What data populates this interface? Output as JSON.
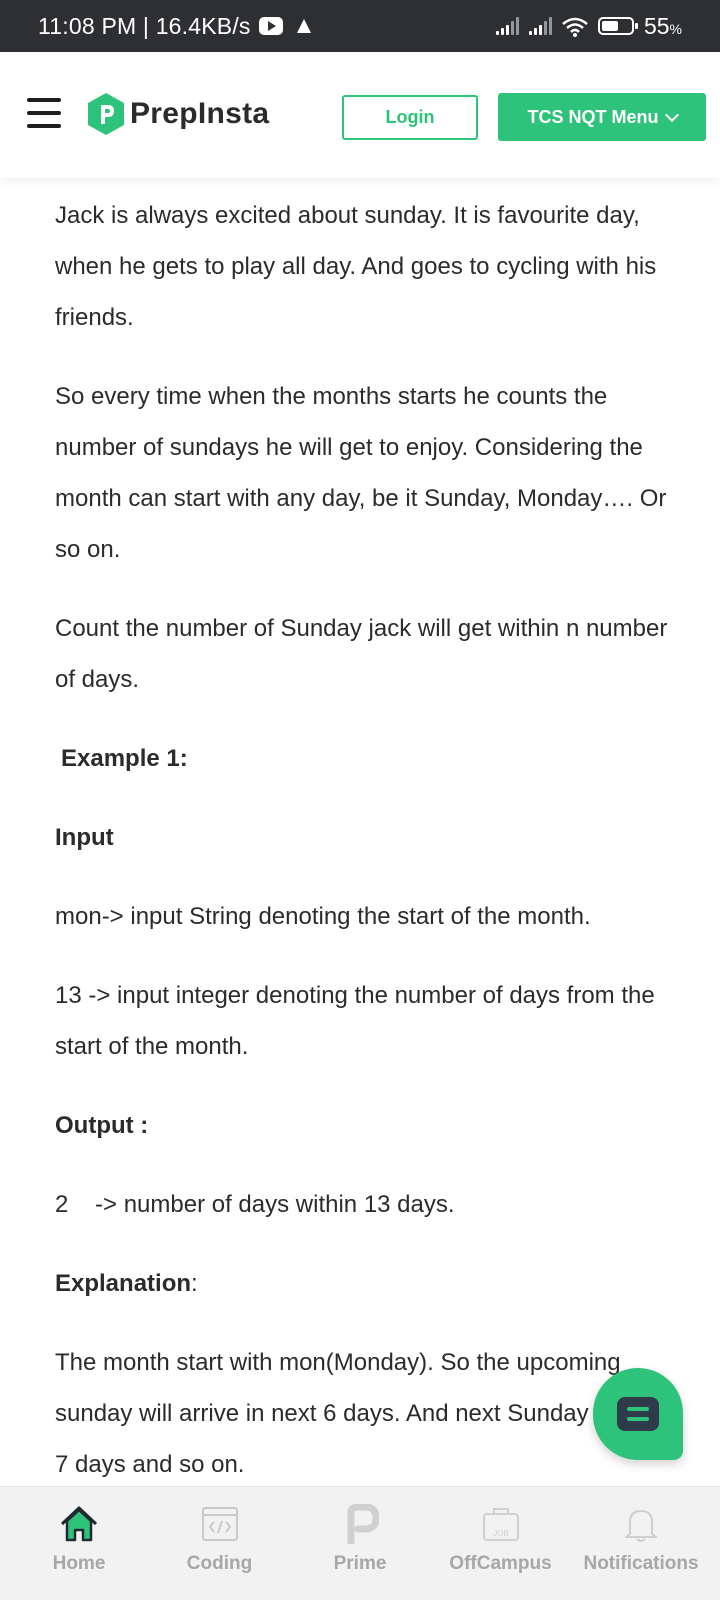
{
  "status_bar": {
    "time_speed": "11:08 PM | 16.4KB/s",
    "battery": "55",
    "battery_unit": "%"
  },
  "header": {
    "logo_text": "PrepInsta",
    "login_label": "Login",
    "menu_label": "TCS NQT Menu"
  },
  "content": {
    "para1": "Jack is always excited about sunday. It is favourite day, when he gets to play all day. And goes to cycling with his friends.",
    "para2": "So every time when the months starts he counts the number of sundays he will get to enjoy. Considering the month can start with any day, be it Sunday, Monday…. Or so on.",
    "para3": "Count the number of Sunday jack will get within n number of days.",
    "example_heading": "Example 1:",
    "input_heading": "Input",
    "input_line1": "mon-> input String denoting the start of the month.",
    "input_line2": "13  -> input integer denoting the number of days from the start of the month.",
    "output_heading": "Output :",
    "output_line": "2    -> number of days within 13 days.",
    "explanation_heading": "Explanation",
    "explanation_colon": ":",
    "explanation_text": "The month start with mon(Monday). So the upcoming sunday will arrive in next 6 days. And next Sunday in next 7 days and so on."
  },
  "bottom_nav": {
    "items": [
      {
        "label": "Home",
        "icon": "home-icon",
        "active": true
      },
      {
        "label": "Coding",
        "icon": "code-icon",
        "active": false
      },
      {
        "label": "Prime",
        "icon": "prime-icon",
        "active": false
      },
      {
        "label": "OffCampus",
        "icon": "job-icon",
        "active": false
      },
      {
        "label": "Notifications",
        "icon": "bell-icon",
        "active": false
      }
    ]
  },
  "colors": {
    "accent": "#2ec37a",
    "status_bar": "#2d2f33",
    "text": "#2b2b2b",
    "nav_inactive": "#a7a7a7"
  }
}
